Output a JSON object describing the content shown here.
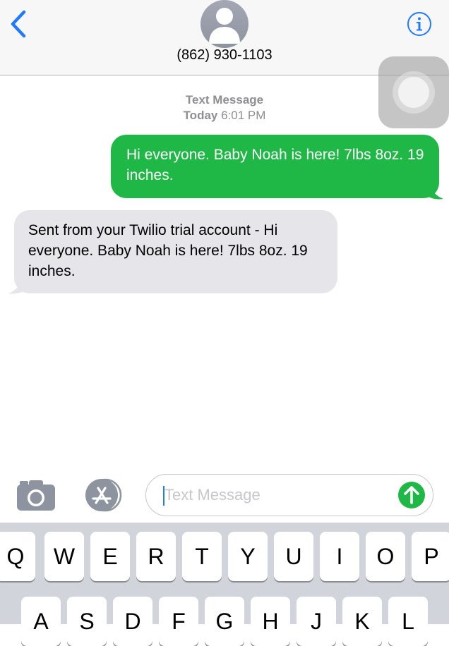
{
  "header": {
    "contact": "(862) 930-1103"
  },
  "thread": {
    "service": "Text Message",
    "date_label": "Today",
    "time": "6:01 PM",
    "sent_message": "Hi everyone. Baby Noah is here! 7lbs 8oz. 19 inches.",
    "received_message": "Sent from your Twilio trial account - Hi everyone. Baby Noah is here! 7lbs 8oz. 19 inches."
  },
  "composer": {
    "placeholder": "Text Message",
    "value": ""
  },
  "keyboard": {
    "row1": [
      "Q",
      "W",
      "E",
      "R",
      "T",
      "Y",
      "U",
      "I",
      "O",
      "P"
    ],
    "row2": [
      "A",
      "S",
      "D",
      "F",
      "G",
      "H",
      "J",
      "K",
      "L"
    ]
  },
  "icons": {
    "back": "chevron-left",
    "info": "info-circle",
    "camera": "camera",
    "apps": "app-store",
    "send": "arrow-up",
    "assistive_touch": "assistive-touch"
  },
  "colors": {
    "accent_blue": "#1f7aff",
    "sms_green": "#1fb846",
    "received_bubble": "#e5e5ea",
    "keyboard_bg": "#d1d5db"
  }
}
